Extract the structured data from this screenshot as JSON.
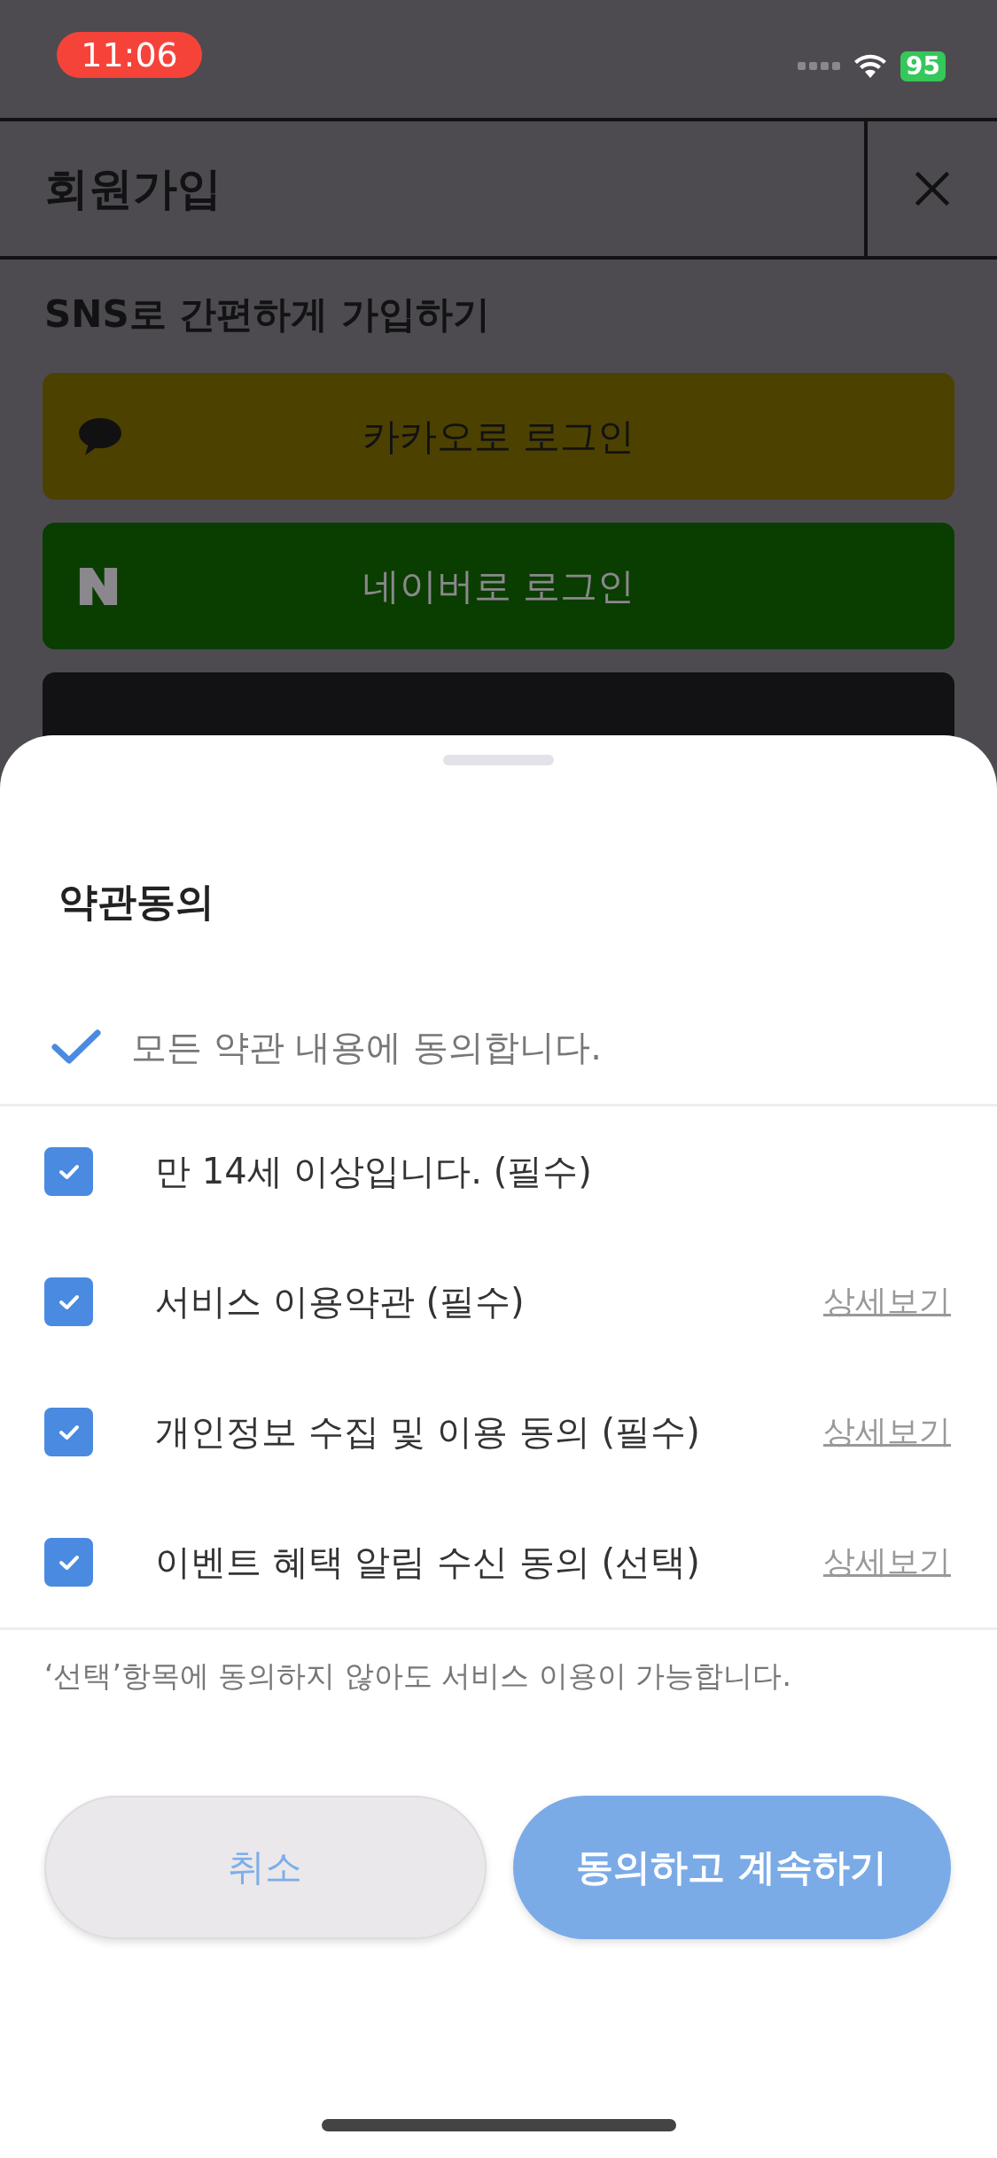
{
  "status_bar": {
    "time": "11:06",
    "battery": "95"
  },
  "header": {
    "title": "회원가입"
  },
  "sns": {
    "heading": "SNS로 간편하게 가입하기",
    "buttons": [
      {
        "kind": "kakao",
        "label": "카카오로 로그인"
      },
      {
        "kind": "naver",
        "label": "네이버로 로그인"
      },
      {
        "kind": "dark"
      }
    ]
  },
  "sheet": {
    "title": "약관동의",
    "agree_all": {
      "label": "모든 약관 내용에 동의합니다.",
      "checked": true
    },
    "terms": [
      {
        "label": "만 14세 이상입니다. (필수)",
        "checked": true
      },
      {
        "label": "서비스 이용약관 (필수)",
        "checked": true,
        "link": "상세보기"
      },
      {
        "label": "개인정보 수집 및 이용 동의 (필수)",
        "checked": true,
        "link": "상세보기"
      },
      {
        "label": "이벤트 혜택 알림 수신 동의 (선택)",
        "checked": true,
        "link": "상세보기"
      }
    ],
    "note": "‘선택’항목에 동의하지 않아도 서비스 이용이 가능합니다.",
    "buttons": [
      {
        "kind": "secondary",
        "label": "취소"
      },
      {
        "kind": "primary",
        "label": "동의하고 계속하기"
      }
    ]
  }
}
